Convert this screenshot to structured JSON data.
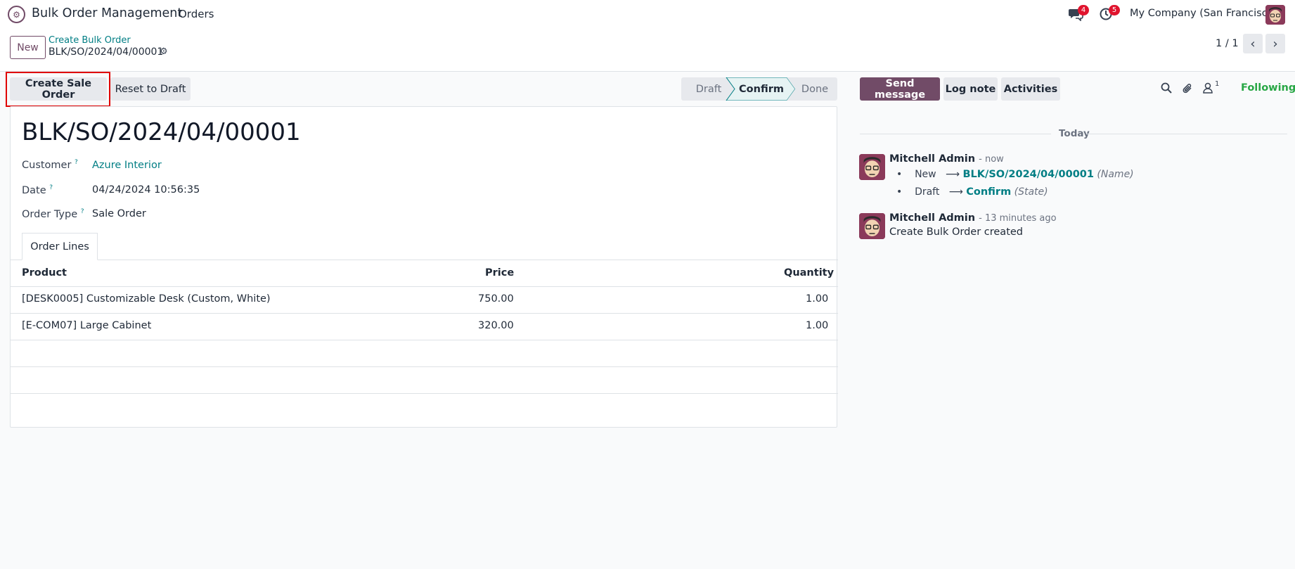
{
  "navbar": {
    "app_name": "Bulk Order Management",
    "menu_orders": "Orders",
    "messages_count": "4",
    "activities_count": "5",
    "company": "My Company (San Francisco)"
  },
  "control": {
    "new_label": "New",
    "breadcrumb_parent": "Create Bulk Order",
    "breadcrumb_current": "BLK/SO/2024/04/00001",
    "pager": "1 / 1"
  },
  "actions": {
    "create_sale_order": "Create Sale Order",
    "reset_to_draft": "Reset to Draft"
  },
  "statusbar": {
    "stages": [
      "Draft",
      "Confirm",
      "Done"
    ],
    "current": "Confirm"
  },
  "form": {
    "name": "BLK/SO/2024/04/00001",
    "customer_label": "Customer",
    "customer_value": "Azure Interior",
    "date_label": "Date",
    "date_value": "04/24/2024 10:56:35",
    "order_type_label": "Order Type",
    "order_type_value": "Sale Order",
    "help_mark": "?",
    "tab_order_lines": "Order Lines",
    "columns": {
      "product": "Product",
      "price": "Price",
      "quantity": "Quantity"
    },
    "lines": [
      {
        "product": "[DESK0005] Customizable Desk (Custom, White)",
        "price": "750.00",
        "quantity": "1.00"
      },
      {
        "product": "[E-COM07] Large Cabinet",
        "price": "320.00",
        "quantity": "1.00"
      }
    ]
  },
  "chatter": {
    "send_message": "Send message",
    "log_note": "Log note",
    "activities": "Activities",
    "followers_count": "1",
    "following": "Following",
    "today": "Today",
    "messages": [
      {
        "author": "Mitchell Admin",
        "time": "- now",
        "tracking": [
          {
            "old": "New",
            "new": "BLK/SO/2024/04/00001",
            "field": "(Name)"
          },
          {
            "old": "Draft",
            "new": "Confirm",
            "field": "(State)"
          }
        ]
      },
      {
        "author": "Mitchell Admin",
        "time": "- 13 minutes ago",
        "body": "Create Bulk Order created"
      }
    ]
  },
  "colors": {
    "brand": "#714b67",
    "link": "#017e84",
    "badge": "#e0142e",
    "following": "#28a745",
    "highlight": "#e00000"
  }
}
